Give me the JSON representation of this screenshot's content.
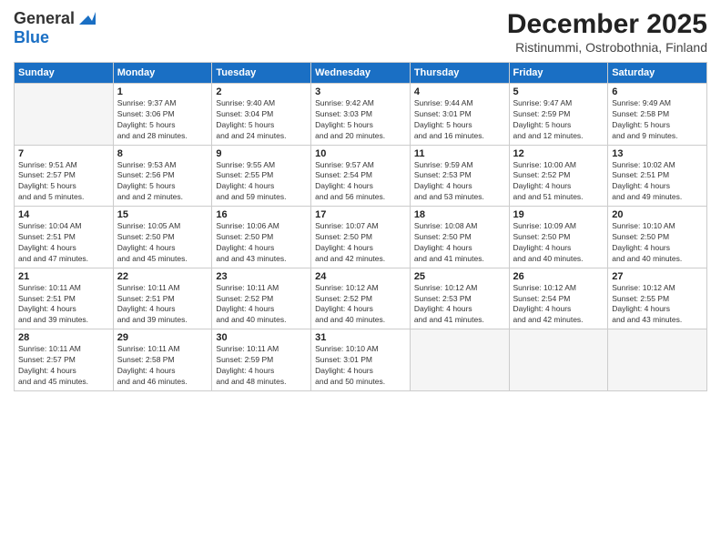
{
  "header": {
    "logo_line1": "General",
    "logo_line2": "Blue",
    "month": "December 2025",
    "location": "Ristinummi, Ostrobothnia, Finland"
  },
  "days_of_week": [
    "Sunday",
    "Monday",
    "Tuesday",
    "Wednesday",
    "Thursday",
    "Friday",
    "Saturday"
  ],
  "weeks": [
    [
      {
        "date": "",
        "empty": true
      },
      {
        "date": "1",
        "sunrise": "Sunrise: 9:37 AM",
        "sunset": "Sunset: 3:06 PM",
        "daylight": "Daylight: 5 hours and 28 minutes."
      },
      {
        "date": "2",
        "sunrise": "Sunrise: 9:40 AM",
        "sunset": "Sunset: 3:04 PM",
        "daylight": "Daylight: 5 hours and 24 minutes."
      },
      {
        "date": "3",
        "sunrise": "Sunrise: 9:42 AM",
        "sunset": "Sunset: 3:03 PM",
        "daylight": "Daylight: 5 hours and 20 minutes."
      },
      {
        "date": "4",
        "sunrise": "Sunrise: 9:44 AM",
        "sunset": "Sunset: 3:01 PM",
        "daylight": "Daylight: 5 hours and 16 minutes."
      },
      {
        "date": "5",
        "sunrise": "Sunrise: 9:47 AM",
        "sunset": "Sunset: 2:59 PM",
        "daylight": "Daylight: 5 hours and 12 minutes."
      },
      {
        "date": "6",
        "sunrise": "Sunrise: 9:49 AM",
        "sunset": "Sunset: 2:58 PM",
        "daylight": "Daylight: 5 hours and 9 minutes."
      }
    ],
    [
      {
        "date": "7",
        "sunrise": "Sunrise: 9:51 AM",
        "sunset": "Sunset: 2:57 PM",
        "daylight": "Daylight: 5 hours and 5 minutes."
      },
      {
        "date": "8",
        "sunrise": "Sunrise: 9:53 AM",
        "sunset": "Sunset: 2:56 PM",
        "daylight": "Daylight: 5 hours and 2 minutes."
      },
      {
        "date": "9",
        "sunrise": "Sunrise: 9:55 AM",
        "sunset": "Sunset: 2:55 PM",
        "daylight": "Daylight: 4 hours and 59 minutes."
      },
      {
        "date": "10",
        "sunrise": "Sunrise: 9:57 AM",
        "sunset": "Sunset: 2:54 PM",
        "daylight": "Daylight: 4 hours and 56 minutes."
      },
      {
        "date": "11",
        "sunrise": "Sunrise: 9:59 AM",
        "sunset": "Sunset: 2:53 PM",
        "daylight": "Daylight: 4 hours and 53 minutes."
      },
      {
        "date": "12",
        "sunrise": "Sunrise: 10:00 AM",
        "sunset": "Sunset: 2:52 PM",
        "daylight": "Daylight: 4 hours and 51 minutes."
      },
      {
        "date": "13",
        "sunrise": "Sunrise: 10:02 AM",
        "sunset": "Sunset: 2:51 PM",
        "daylight": "Daylight: 4 hours and 49 minutes."
      }
    ],
    [
      {
        "date": "14",
        "sunrise": "Sunrise: 10:04 AM",
        "sunset": "Sunset: 2:51 PM",
        "daylight": "Daylight: 4 hours and 47 minutes."
      },
      {
        "date": "15",
        "sunrise": "Sunrise: 10:05 AM",
        "sunset": "Sunset: 2:50 PM",
        "daylight": "Daylight: 4 hours and 45 minutes."
      },
      {
        "date": "16",
        "sunrise": "Sunrise: 10:06 AM",
        "sunset": "Sunset: 2:50 PM",
        "daylight": "Daylight: 4 hours and 43 minutes."
      },
      {
        "date": "17",
        "sunrise": "Sunrise: 10:07 AM",
        "sunset": "Sunset: 2:50 PM",
        "daylight": "Daylight: 4 hours and 42 minutes."
      },
      {
        "date": "18",
        "sunrise": "Sunrise: 10:08 AM",
        "sunset": "Sunset: 2:50 PM",
        "daylight": "Daylight: 4 hours and 41 minutes."
      },
      {
        "date": "19",
        "sunrise": "Sunrise: 10:09 AM",
        "sunset": "Sunset: 2:50 PM",
        "daylight": "Daylight: 4 hours and 40 minutes."
      },
      {
        "date": "20",
        "sunrise": "Sunrise: 10:10 AM",
        "sunset": "Sunset: 2:50 PM",
        "daylight": "Daylight: 4 hours and 40 minutes."
      }
    ],
    [
      {
        "date": "21",
        "sunrise": "Sunrise: 10:11 AM",
        "sunset": "Sunset: 2:51 PM",
        "daylight": "Daylight: 4 hours and 39 minutes."
      },
      {
        "date": "22",
        "sunrise": "Sunrise: 10:11 AM",
        "sunset": "Sunset: 2:51 PM",
        "daylight": "Daylight: 4 hours and 39 minutes."
      },
      {
        "date": "23",
        "sunrise": "Sunrise: 10:11 AM",
        "sunset": "Sunset: 2:52 PM",
        "daylight": "Daylight: 4 hours and 40 minutes."
      },
      {
        "date": "24",
        "sunrise": "Sunrise: 10:12 AM",
        "sunset": "Sunset: 2:52 PM",
        "daylight": "Daylight: 4 hours and 40 minutes."
      },
      {
        "date": "25",
        "sunrise": "Sunrise: 10:12 AM",
        "sunset": "Sunset: 2:53 PM",
        "daylight": "Daylight: 4 hours and 41 minutes."
      },
      {
        "date": "26",
        "sunrise": "Sunrise: 10:12 AM",
        "sunset": "Sunset: 2:54 PM",
        "daylight": "Daylight: 4 hours and 42 minutes."
      },
      {
        "date": "27",
        "sunrise": "Sunrise: 10:12 AM",
        "sunset": "Sunset: 2:55 PM",
        "daylight": "Daylight: 4 hours and 43 minutes."
      }
    ],
    [
      {
        "date": "28",
        "sunrise": "Sunrise: 10:11 AM",
        "sunset": "Sunset: 2:57 PM",
        "daylight": "Daylight: 4 hours and 45 minutes."
      },
      {
        "date": "29",
        "sunrise": "Sunrise: 10:11 AM",
        "sunset": "Sunset: 2:58 PM",
        "daylight": "Daylight: 4 hours and 46 minutes."
      },
      {
        "date": "30",
        "sunrise": "Sunrise: 10:11 AM",
        "sunset": "Sunset: 2:59 PM",
        "daylight": "Daylight: 4 hours and 48 minutes."
      },
      {
        "date": "31",
        "sunrise": "Sunrise: 10:10 AM",
        "sunset": "Sunset: 3:01 PM",
        "daylight": "Daylight: 4 hours and 50 minutes."
      },
      {
        "date": "",
        "empty": true
      },
      {
        "date": "",
        "empty": true
      },
      {
        "date": "",
        "empty": true
      }
    ]
  ]
}
